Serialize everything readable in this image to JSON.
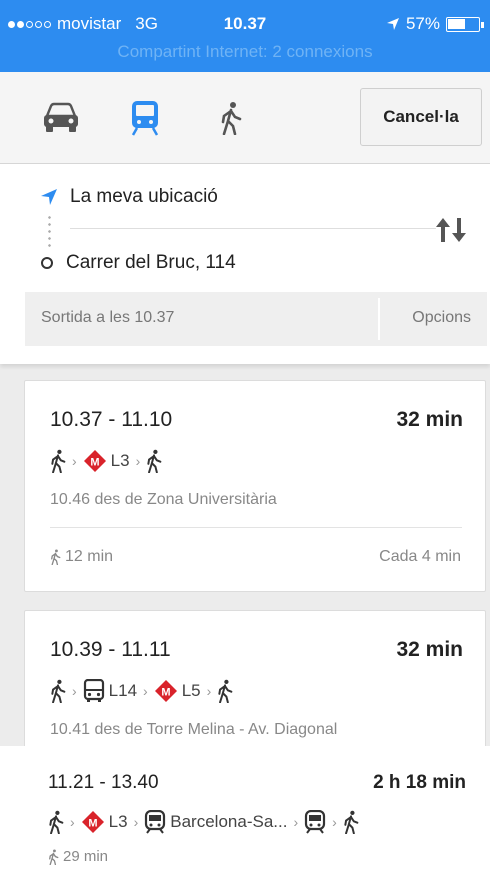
{
  "status_bar": {
    "carrier": "movistar",
    "network": "3G",
    "time": "10.37",
    "battery": "57%",
    "battery_level": 0.57,
    "hotspot": "Compartint Internet: 2 connexions"
  },
  "modes": {
    "car_icon": "car-icon",
    "transit_icon": "train-icon",
    "walk_icon": "walk-icon",
    "active": "transit",
    "active_color": "#2d8cf0",
    "cancel_label": "Cancel·la"
  },
  "route": {
    "origin": "La meva ubicació",
    "destination": "Carrer del Bruc, 114",
    "departure": "Sortida a les 10.37",
    "options": "Opcions"
  },
  "results": [
    {
      "times": "10.37 - 11.10",
      "duration": "32 min",
      "steps": [
        {
          "type": "walk"
        },
        {
          "type": "metro",
          "label": "L3"
        },
        {
          "type": "walk"
        }
      ],
      "from": "10.46 des de Zona Universitària",
      "walk": "12 min",
      "frequency": "Cada 4 min"
    },
    {
      "times": "10.39 - 11.11",
      "duration": "32 min",
      "steps": [
        {
          "type": "walk"
        },
        {
          "type": "bus",
          "label": "L14"
        },
        {
          "type": "metro",
          "label": "L5"
        },
        {
          "type": "walk"
        }
      ],
      "from": "10.41 des de Torre Melina - Av. Diagonal"
    },
    {
      "times": "11.21 - 13.40",
      "duration": "2 h 18 min",
      "steps": [
        {
          "type": "walk"
        },
        {
          "type": "metro",
          "label": "L3"
        },
        {
          "type": "train",
          "label": "Barcelona-Sa..."
        },
        {
          "type": "train"
        },
        {
          "type": "walk"
        }
      ],
      "walk": "29 min"
    }
  ],
  "colors": {
    "accent": "#2d8cf0",
    "metro_red": "#d9232b"
  }
}
